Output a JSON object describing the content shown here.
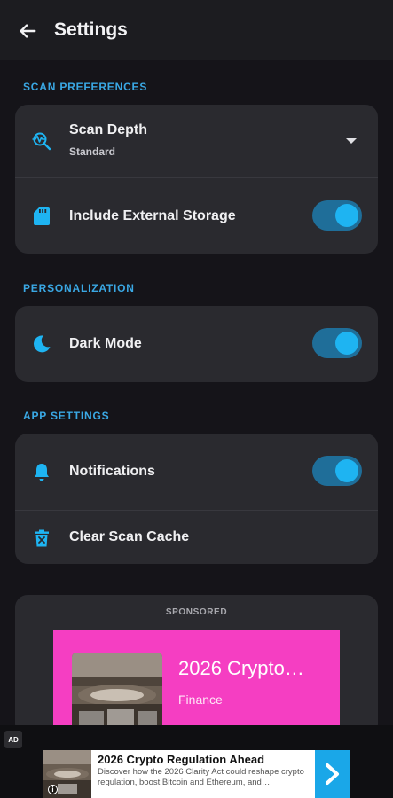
{
  "appbar": {
    "title": "Settings",
    "back_icon": "arrow-left-icon"
  },
  "sections": {
    "scan": {
      "label": "SCAN PREFERENCES",
      "scan_depth": {
        "label": "Scan Depth",
        "value": "Standard",
        "icon": "scan-search-icon"
      },
      "external_storage": {
        "label": "Include External Storage",
        "enabled": true,
        "icon": "sd-card-icon"
      }
    },
    "personalization": {
      "label": "PERSONALIZATION",
      "dark_mode": {
        "label": "Dark Mode",
        "enabled": true,
        "icon": "moon-icon"
      }
    },
    "app": {
      "label": "APP SETTINGS",
      "notifications": {
        "label": "Notifications",
        "enabled": true,
        "icon": "bell-icon"
      },
      "clear_cache": {
        "label": "Clear Scan Cache",
        "icon": "trash-icon"
      }
    }
  },
  "sponsored": {
    "label": "SPONSORED",
    "headline": "2026 Crypto…",
    "category": "Finance"
  },
  "banner_ad": {
    "badge": "AD",
    "title": "2026 Crypto Regulation Ahead",
    "description": "Discover how the 2026 Clarity Act could reshape crypto regulation, boost Bitcoin and Ethereum, and…",
    "info": "i"
  },
  "colors": {
    "accent": "#1EB4F2",
    "section_label": "#3AA8E4",
    "card": "#2A2A2F",
    "background": "#151419",
    "sponsor_bg": "#F53EC2"
  }
}
